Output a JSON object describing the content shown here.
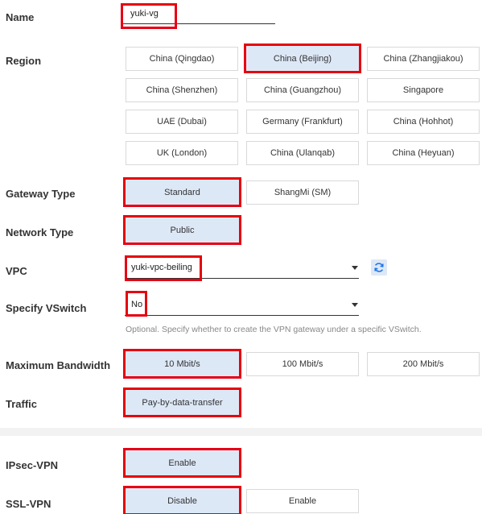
{
  "name": {
    "label": "Name",
    "value": "yuki-vg"
  },
  "region": {
    "label": "Region",
    "options": [
      "China (Qingdao)",
      "China (Beijing)",
      "China (Zhangjiakou)",
      "China (Shenzhen)",
      "China (Guangzhou)",
      "Singapore",
      "UAE (Dubai)",
      "Germany (Frankfurt)",
      "China (Hohhot)",
      "UK (London)",
      "China (Ulanqab)",
      "China (Heyuan)"
    ],
    "selected": "China (Beijing)"
  },
  "gateway_type": {
    "label": "Gateway Type",
    "options": [
      "Standard",
      "ShangMi (SM)"
    ],
    "selected": "Standard"
  },
  "network_type": {
    "label": "Network Type",
    "options": [
      "Public"
    ],
    "selected": "Public"
  },
  "vpc": {
    "label": "VPC",
    "value": "yuki-vpc-beiling"
  },
  "vswitch": {
    "label": "Specify VSwitch",
    "value": "No",
    "hint": "Optional. Specify whether to create the VPN gateway under a specific VSwitch."
  },
  "bandwidth": {
    "label": "Maximum Bandwidth",
    "options": [
      "10 Mbit/s",
      "100 Mbit/s",
      "200 Mbit/s"
    ],
    "selected": "10 Mbit/s"
  },
  "traffic": {
    "label": "Traffic",
    "options": [
      "Pay-by-data-transfer"
    ],
    "selected": "Pay-by-data-transfer"
  },
  "ipsec_vpn": {
    "label": "IPsec-VPN",
    "options": [
      "Enable"
    ],
    "selected": "Enable"
  },
  "ssl_vpn": {
    "label": "SSL-VPN",
    "options": [
      "Disable",
      "Enable"
    ],
    "selected": "Disable"
  },
  "colors": {
    "highlight": "#e60012",
    "selected_bg": "#dde8f7",
    "accent": "#1a73e8"
  }
}
